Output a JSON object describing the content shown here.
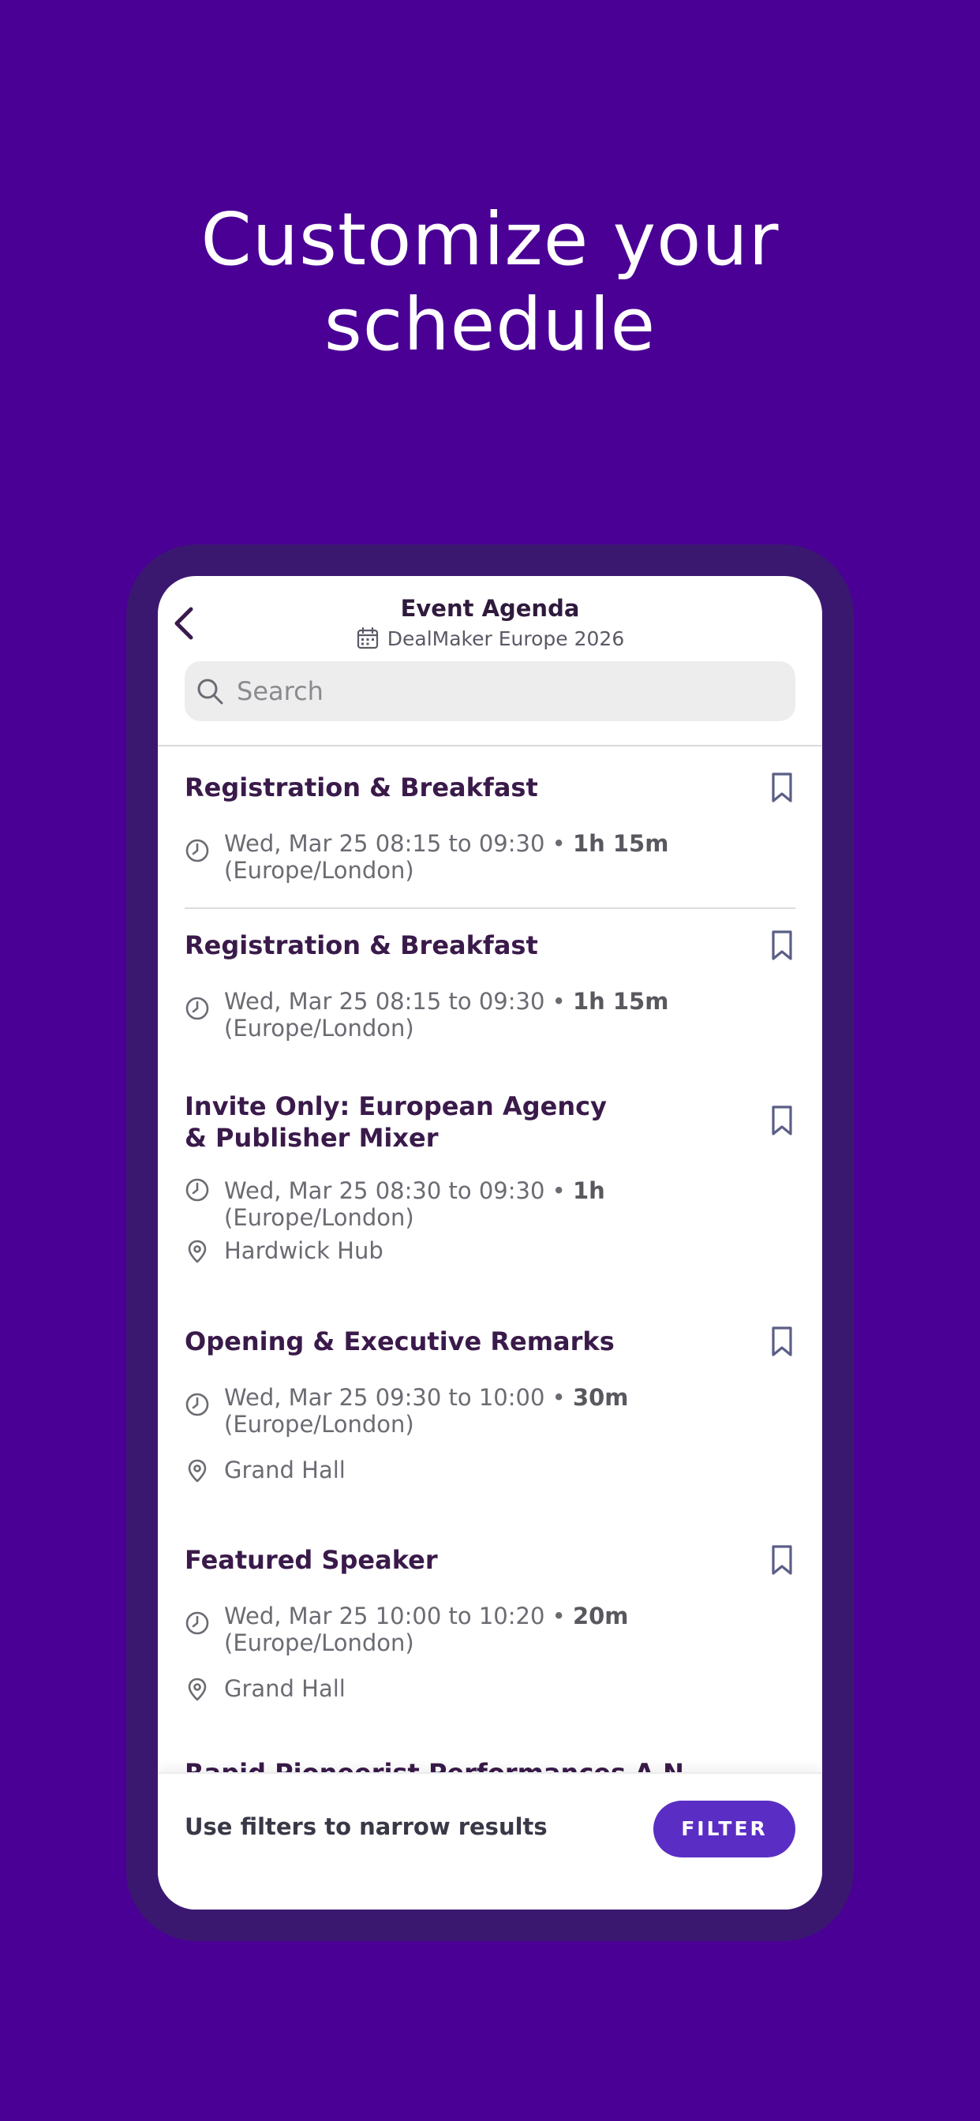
{
  "headline": {
    "line1": "Customize your",
    "line2": "schedule"
  },
  "nav": {
    "back_icon": "chevron-left-icon",
    "title": "Event Agenda",
    "calendar_icon": "calendar-icon",
    "subtitle": "DealMaker Europe 2026"
  },
  "search": {
    "icon": "search-icon",
    "placeholder": "Search",
    "value": ""
  },
  "sessions": [
    {
      "title": "Registration & Breakfast",
      "time": "Wed, Mar 25 08:15 to 09:30 •",
      "duration": "1h 15m",
      "timezone": "(Europe/London)",
      "location": ""
    },
    {
      "title": "Registration & Breakfast",
      "time": "Wed, Mar 25 08:15 to 09:30 •",
      "duration": "1h 15m",
      "timezone": "(Europe/London)",
      "location": ""
    },
    {
      "title": "Invite Only: European Agency & Publisher Mixer",
      "time": "Wed, Mar 25 08:30 to 09:30 •",
      "duration": "1h",
      "timezone": "(Europe/London)",
      "location": "Hardwick Hub"
    },
    {
      "title": "Opening & Executive Remarks",
      "time": "Wed, Mar 25 09:30 to 10:00 •",
      "duration": "30m",
      "timezone": "(Europe/London)",
      "location": "Grand Hall"
    },
    {
      "title": "Featured Speaker",
      "time": "Wed, Mar 25 10:00 to 10:20 •",
      "duration": "20m",
      "timezone": "(Europe/London)",
      "location": "Grand Hall"
    }
  ],
  "peek_title": "Rapid Pioneerist Performances A N...",
  "footer": {
    "text": "Use filters to narrow results",
    "filter_label": "FILTER"
  },
  "colors": {
    "background": "#4a0095",
    "phone_frame": "#3b1870",
    "accent": "#5a2ec4",
    "title_text": "#3a1a4a"
  }
}
